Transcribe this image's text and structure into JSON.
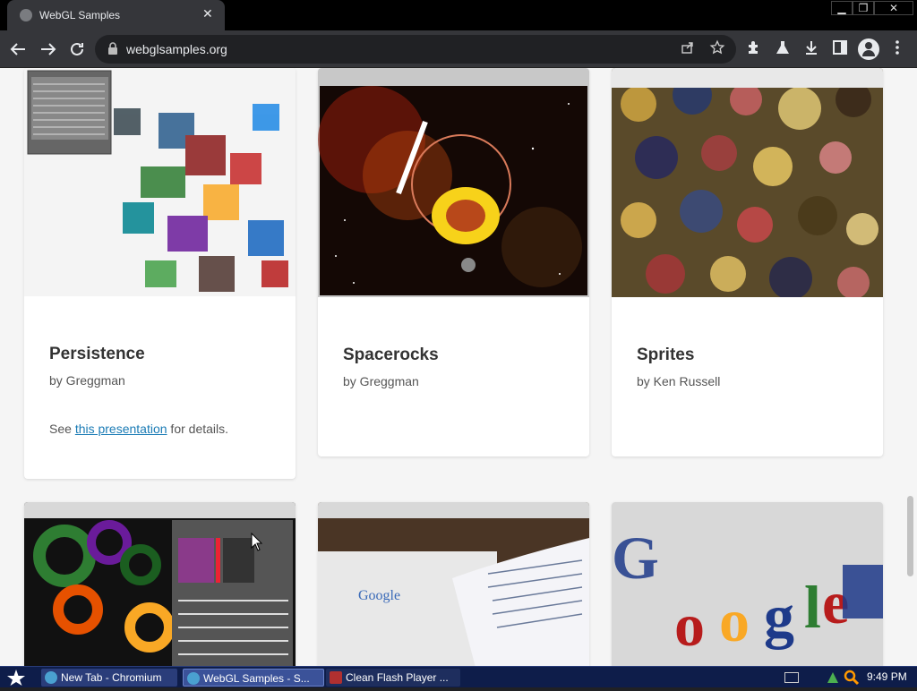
{
  "browser": {
    "tab_title": "WebGL Samples",
    "tab_close": "✕",
    "url": "webglsamples.org",
    "window_controls": {
      "minimize": "▁",
      "restore": "❐",
      "close": "✕"
    },
    "icons": [
      "back-icon",
      "forward-icon",
      "reload-icon",
      "lock-icon",
      "share-icon",
      "star-icon",
      "extensions-icon",
      "labs-icon",
      "download-icon",
      "sidepanel-icon",
      "profile-icon",
      "menu-icon"
    ]
  },
  "cards": [
    {
      "title": "Persistence",
      "author": "by Greggman",
      "desc_prefix": "See ",
      "desc_link": "this presentation",
      "desc_suffix": " for details."
    },
    {
      "title": "Spacerocks",
      "author": "by Greggman"
    },
    {
      "title": "Sprites",
      "author": "by Ken Russell"
    }
  ],
  "taskbar": {
    "items": [
      {
        "label": "New Tab - Chromium"
      },
      {
        "label": "WebGL Samples - S..."
      },
      {
        "label": "Clean Flash Player ..."
      }
    ],
    "clock": "9:49 PM"
  },
  "colors": {
    "accent_link": "#1a7bb5",
    "taskbar": "#0e1d4a",
    "browser_chrome": "#35363a"
  }
}
